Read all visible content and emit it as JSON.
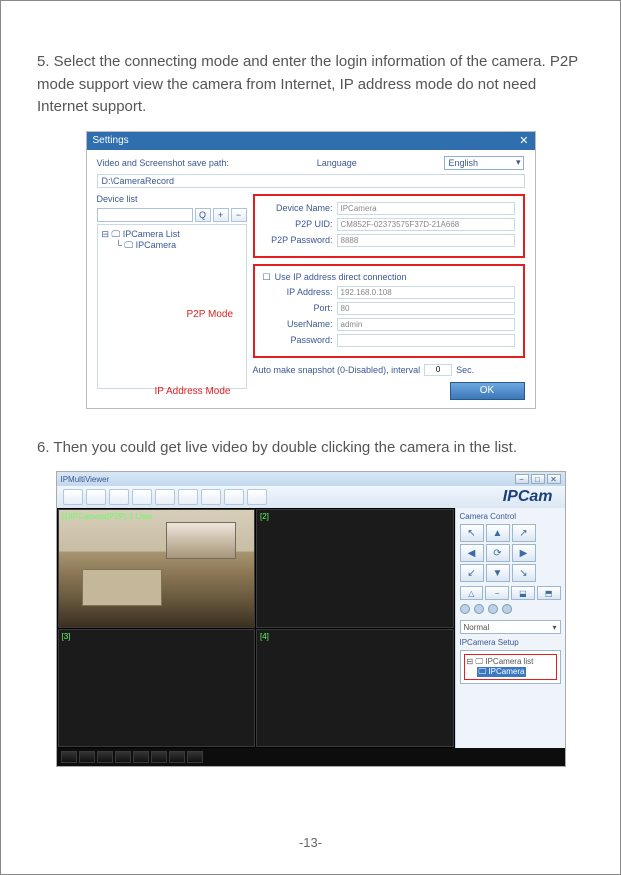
{
  "step5": "5. Select the connecting mode and enter the login information of the camera. P2P mode support view the camera from Internet, IP address mode do not need Internet support.",
  "step6": "6. Then you could get live video by double clicking the camera in the list.",
  "pageNum": "-13-",
  "settings": {
    "title": "Settings",
    "pathLabel": "Video and Screenshot save path:",
    "path": "D:\\CameraRecord",
    "langLabel": "Language",
    "langValue": "English",
    "devListLabel": "Device list",
    "treeRoot": "IPCamera List",
    "treeChild": "IPCamera",
    "p2pAnnot": "P2P Mode",
    "ipAnnot": "IP Address Mode",
    "devName": {
      "label": "Device Name:",
      "value": "IPCamera"
    },
    "p2pUid": {
      "label": "P2P UID:",
      "value": "CM852F-02373575F37D-21A668"
    },
    "p2pPwd": {
      "label": "P2P Password:",
      "value": "8888"
    },
    "useIpLabel": "Use IP address direct connection",
    "ipAddr": {
      "label": "IP Address:",
      "value": "192.168.0.108"
    },
    "port": {
      "label": "Port:",
      "value": "80"
    },
    "userName": {
      "label": "UserName:",
      "value": "admin"
    },
    "password": {
      "label": "Password:",
      "value": ""
    },
    "snapText": "Auto make snapshot (0-Disabled), interval",
    "snapVal": "0",
    "snapSec": "Sec.",
    "ok": "OK"
  },
  "viewer": {
    "title": "IPMultiViewer",
    "logo": "IPCam",
    "camControl": "Camera Control",
    "cell1": "[1]IPCamera(P2P) 1 User",
    "cell2": "[2]",
    "cell3": "[3]",
    "cell4": "[4]",
    "normal": "Normal",
    "setupTitle": "IPCamera Setup",
    "listRoot": "IPCamera list",
    "listChild": "IPCamera"
  }
}
